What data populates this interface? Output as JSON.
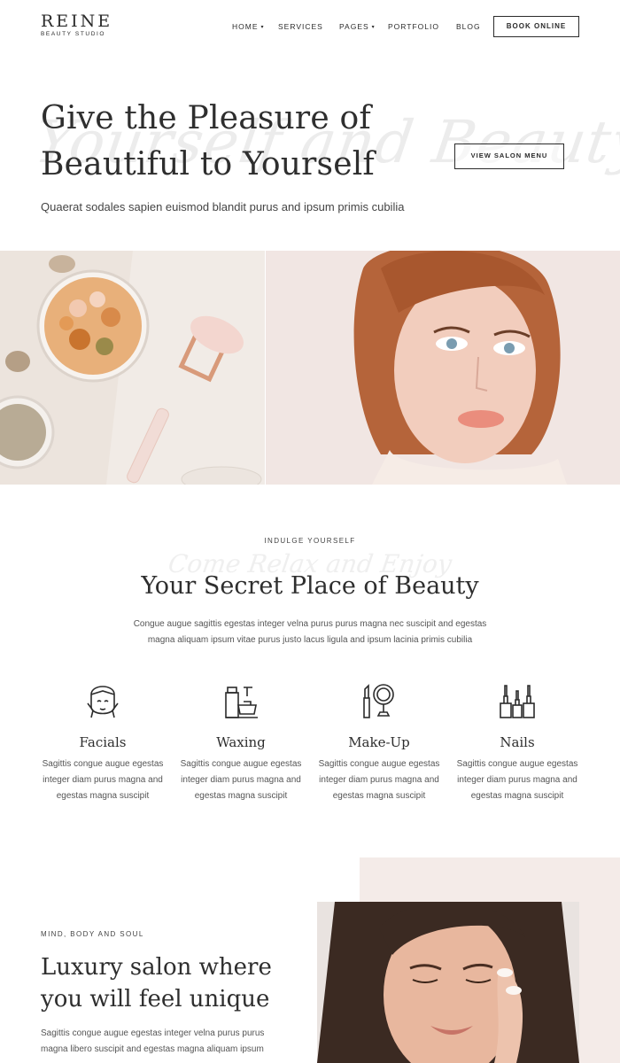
{
  "brand": {
    "name": "REINE",
    "tagline": "BEAUTY STUDIO"
  },
  "nav": {
    "items": [
      {
        "label": "HOME",
        "has_dropdown": true
      },
      {
        "label": "SERVICES",
        "has_dropdown": false
      },
      {
        "label": "PAGES",
        "has_dropdown": true
      },
      {
        "label": "PORTFOLIO",
        "has_dropdown": false
      },
      {
        "label": "BLOG",
        "has_dropdown": false
      }
    ],
    "book_label": "BOOK ONLINE",
    "caret": "▾"
  },
  "hero": {
    "title": "Give the Pleasure of Beautiful to Yourself",
    "script_text": "Yourself and Beauty",
    "subtitle": "Quaerat sodales sapien euismod blandit purus and ipsum primis cubilia",
    "menu_button": "VIEW SALON MENU"
  },
  "images": {
    "left": "spa-products-image",
    "right": "model-portrait-image",
    "bottom": "model-skincare-image"
  },
  "services_section": {
    "kicker": "INDULGE YOURSELF",
    "script_text": "Come Relax and Enjoy",
    "title": "Your Secret Place of Beauty",
    "description": "Congue augue sagittis egestas integer velna purus purus magna nec suscipit and egestas magna aliquam ipsum vitae purus justo lacus ligula and ipsum lacinia primis cubilia",
    "items": [
      {
        "icon": "facial-icon",
        "name": "Facials",
        "description": "Sagittis congue augue egestas integer diam purus magna and egestas magna suscipit"
      },
      {
        "icon": "waxing-icon",
        "name": "Waxing",
        "description": "Sagittis congue augue egestas integer diam purus magna and egestas magna suscipit"
      },
      {
        "icon": "makeup-icon",
        "name": "Make-Up",
        "description": "Sagittis congue augue egestas integer diam purus magna and egestas magna suscipit"
      },
      {
        "icon": "nails-icon",
        "name": "Nails",
        "description": "Sagittis congue augue egestas integer diam purus magna and egestas magna suscipit"
      }
    ]
  },
  "luxury_section": {
    "kicker": "MIND, BODY AND SOUL",
    "title": "Luxury salon where you will feel unique",
    "description": "Sagittis congue augue egestas integer velna purus purus magna libero suscipit and egestas magna aliquam ipsum"
  },
  "colors": {
    "text": "#2b2b2b",
    "accent_pink": "#f4ebe8",
    "script_gray": "#ececec"
  }
}
